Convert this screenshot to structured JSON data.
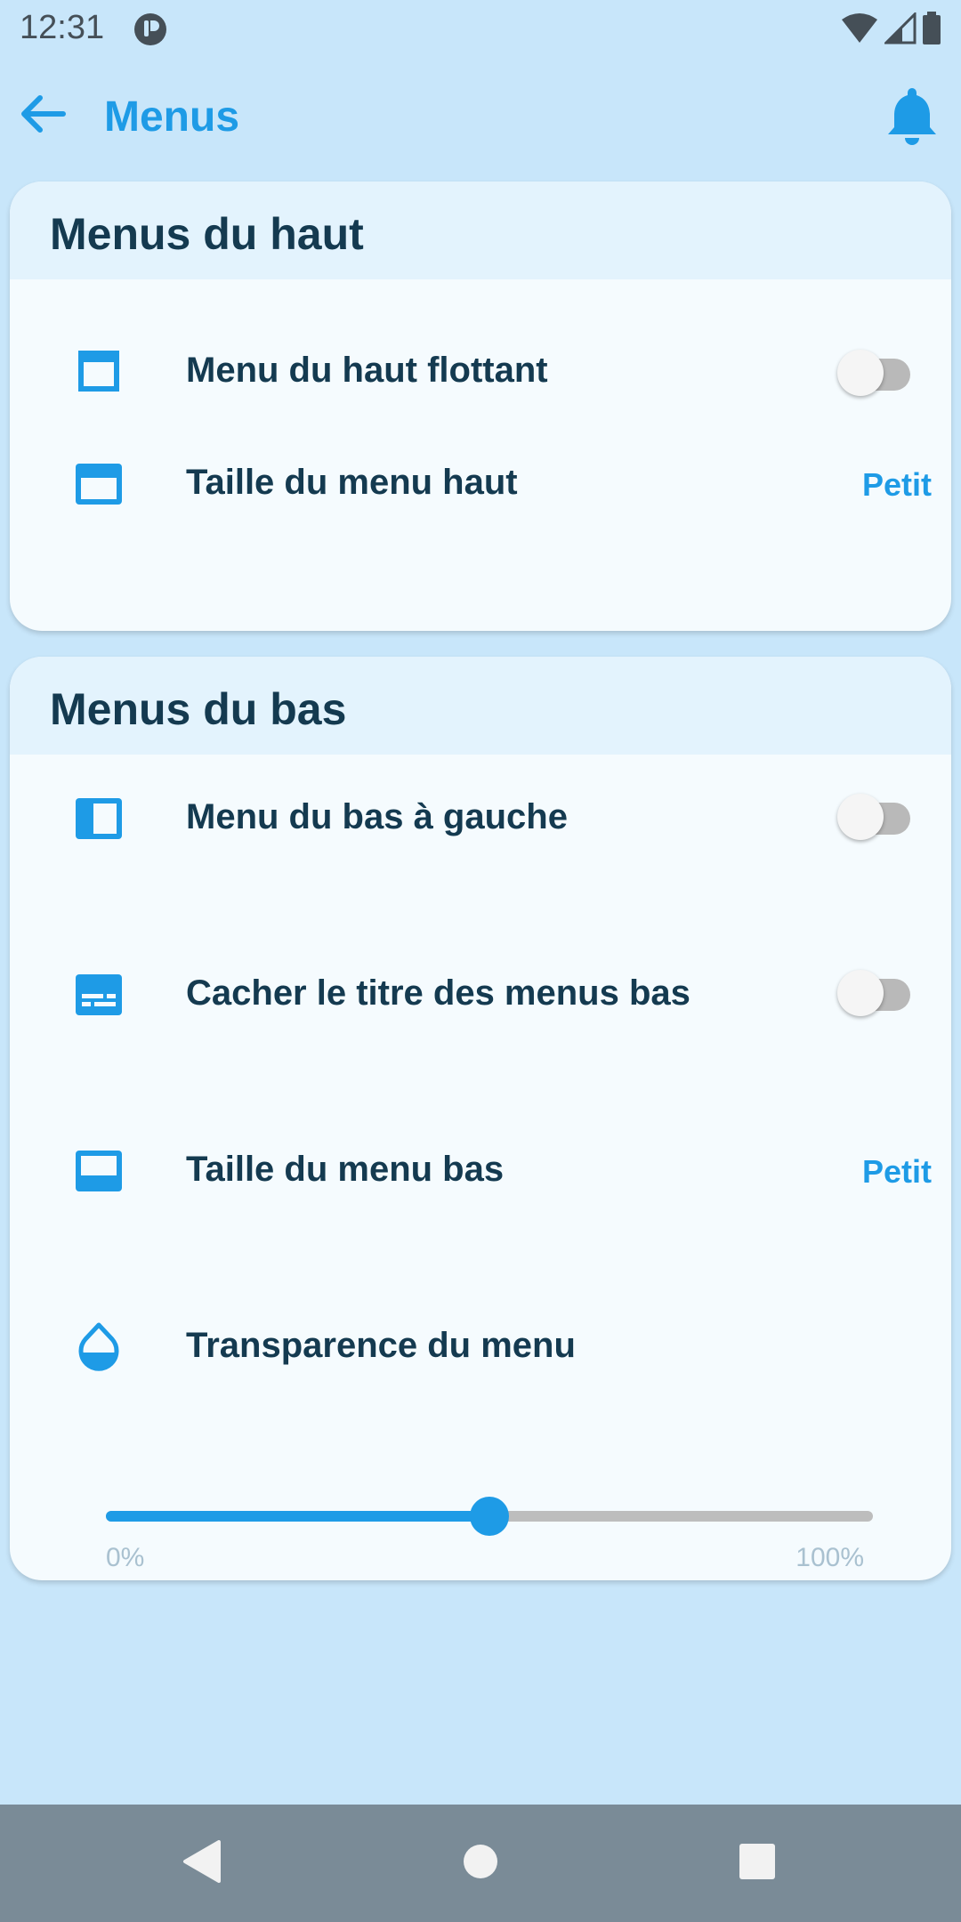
{
  "status_bar": {
    "time": "12:31",
    "icons": [
      "app-notification-icon",
      "wifi-icon",
      "signal-icon",
      "battery-icon"
    ]
  },
  "app_bar": {
    "title": "Menus",
    "back_icon": "arrow-left-icon",
    "bell_icon": "bell-icon"
  },
  "colors": {
    "accent": "#1e9be6",
    "background": "#c8e6fa",
    "card": "#f5fbfe",
    "card_header": "#e3f3fd",
    "text_dark": "#143a50",
    "nav_bar": "#7a8b97"
  },
  "sections": [
    {
      "title": "Menus du haut",
      "items": [
        {
          "icon": "window-frame-icon",
          "label": "Menu du haut flottant",
          "type": "toggle",
          "checked": false
        },
        {
          "icon": "top-bar-icon",
          "label": "Taille du menu haut",
          "type": "value",
          "value": "Petit"
        }
      ]
    },
    {
      "title": "Menus du bas",
      "items": [
        {
          "icon": "left-panel-icon",
          "label": "Menu du bas à gauche",
          "type": "toggle",
          "checked": false
        },
        {
          "icon": "subtitles-icon",
          "label": "Cacher le titre des menus bas",
          "type": "toggle",
          "checked": false
        },
        {
          "icon": "bottom-bar-icon",
          "label": "Taille du menu bas",
          "type": "value",
          "value": "Petit"
        },
        {
          "icon": "drop-icon",
          "label": "Transparence du menu",
          "type": "slider"
        }
      ],
      "slider": {
        "value_fraction": 0.5,
        "min_label": "0%",
        "max_label": "100%"
      }
    }
  ],
  "nav_bar": {
    "icons": [
      "back-triangle-icon",
      "home-circle-icon",
      "recents-square-icon"
    ]
  }
}
